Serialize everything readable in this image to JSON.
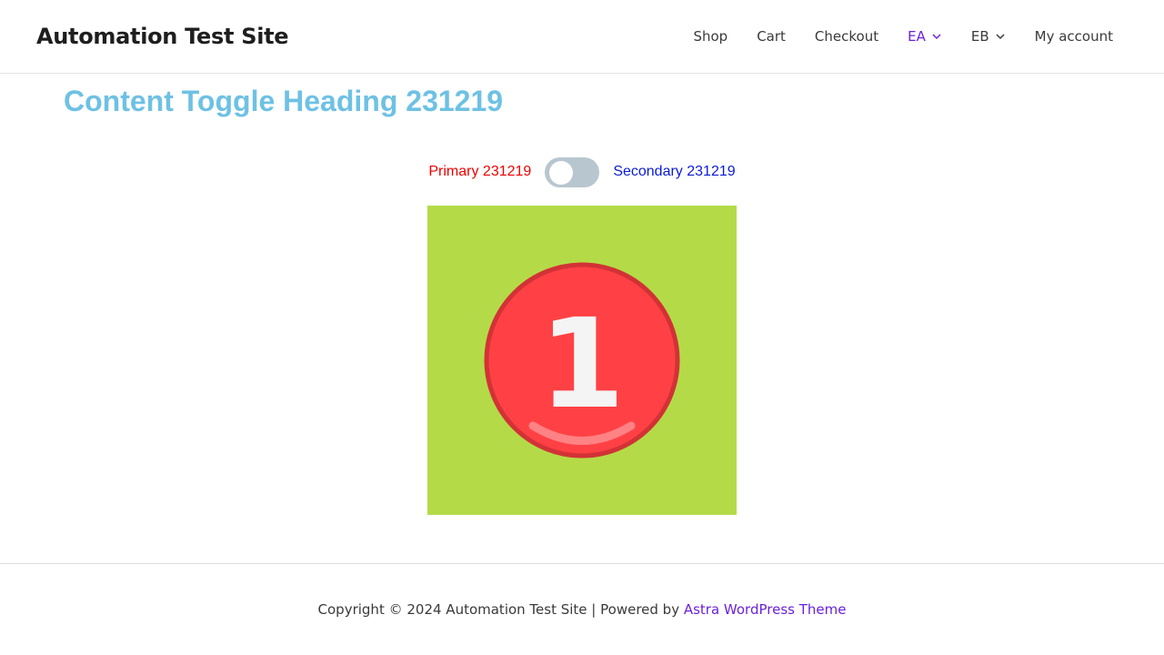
{
  "header": {
    "site_title": "Automation Test Site",
    "nav": [
      {
        "label": "Shop"
      },
      {
        "label": "Cart"
      },
      {
        "label": "Checkout"
      },
      {
        "label": "EA",
        "has_dropdown": true,
        "active": true
      },
      {
        "label": "EB",
        "has_dropdown": true
      },
      {
        "label": "My account"
      }
    ]
  },
  "content": {
    "heading": "Content Toggle Heading 231219",
    "primary_label": "Primary 231219",
    "secondary_label": "Secondary 231219",
    "toggle_state": "primary",
    "image": {
      "icon": "number-one-badge-icon",
      "number": "1",
      "background": "#b4db47",
      "badge_color": "#ff4145"
    }
  },
  "footer": {
    "copyright": "Copyright © 2024 Automation Test Site | Powered by ",
    "theme_link": "Astra WordPress Theme"
  },
  "colors": {
    "accent": "#6b23d9",
    "heading": "#6ec1e4",
    "primary": "#ee0000",
    "secondary": "#0a1bd6"
  }
}
